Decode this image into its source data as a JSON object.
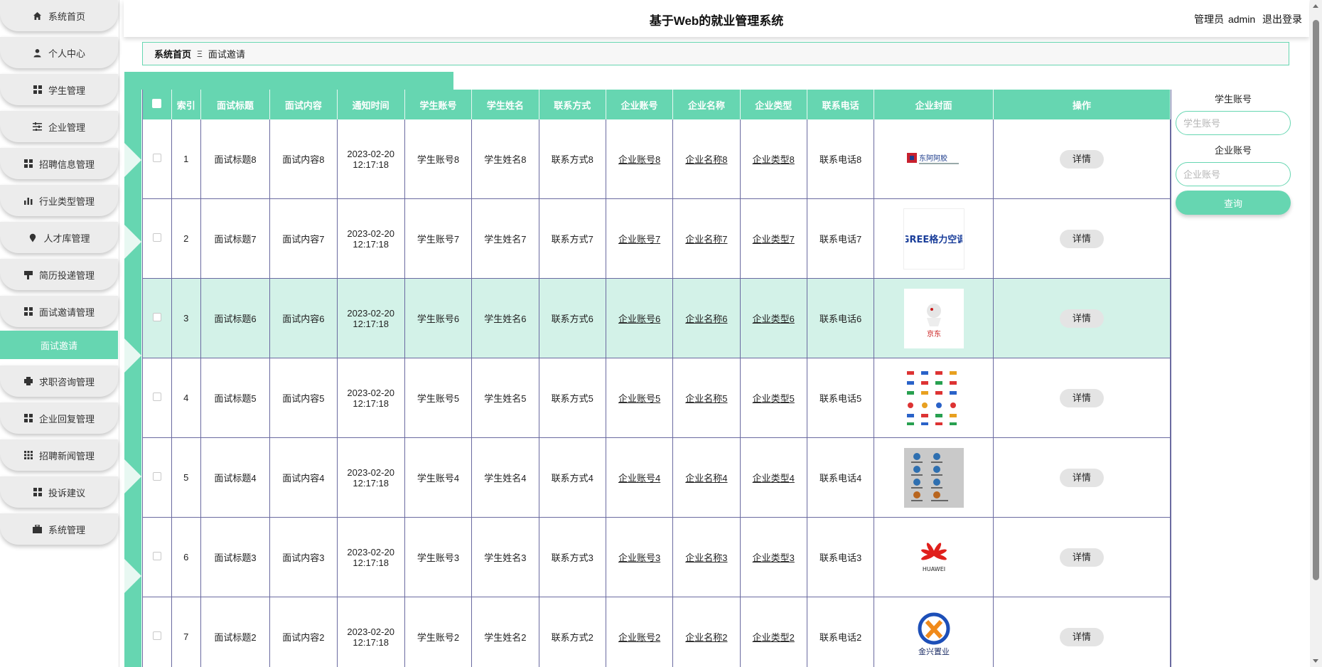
{
  "app": {
    "title": "基于Web的就业管理系统",
    "admin_role": "管理员",
    "admin_name": "admin",
    "logout": "退出登录"
  },
  "sidebar": {
    "items": [
      {
        "label": "系统首页",
        "icon": "home-icon"
      },
      {
        "label": "个人中心",
        "icon": "user-icon"
      },
      {
        "label": "学生管理",
        "icon": "grid-icon"
      },
      {
        "label": "企业管理",
        "icon": "sliders-icon"
      },
      {
        "label": "招聘信息管理",
        "icon": "grid-icon"
      },
      {
        "label": "行业类型管理",
        "icon": "bar-chart-icon"
      },
      {
        "label": "人才库管理",
        "icon": "pin-icon"
      },
      {
        "label": "简历投递管理",
        "icon": "flag-icon"
      },
      {
        "label": "面试邀请管理",
        "icon": "grid-icon"
      },
      {
        "label": "求职咨询管理",
        "icon": "printer-icon"
      },
      {
        "label": "企业回复管理",
        "icon": "grid-icon"
      },
      {
        "label": "招聘新闻管理",
        "icon": "grid9-icon"
      },
      {
        "label": "投诉建议",
        "icon": "grid-icon"
      },
      {
        "label": "系统管理",
        "icon": "briefcase-icon"
      }
    ],
    "active_sub": "面试邀请"
  },
  "breadcrumb": {
    "home": "系统首页",
    "separator": "Ξ",
    "current": "面试邀请"
  },
  "table": {
    "columns": [
      "索引",
      "面试标题",
      "面试内容",
      "通知时间",
      "学生账号",
      "学生姓名",
      "联系方式",
      "企业账号",
      "企业名称",
      "企业类型",
      "联系电话",
      "企业封面",
      "操作"
    ],
    "detail_label": "详情",
    "rows": [
      {
        "index": "1",
        "title": "面试标题8",
        "content": "面试内容8",
        "time": "2023-02-20 12:17:18",
        "student_account": "学生账号8",
        "student_name": "学生姓名8",
        "contact": "联系方式8",
        "company_account": "企业账号8",
        "company_name": "企业名称8",
        "company_type": "企业类型8",
        "phone": "联系电话8",
        "cover": "dongfang-logo",
        "cover_text": "东阿阿胶"
      },
      {
        "index": "2",
        "title": "面试标题7",
        "content": "面试内容7",
        "time": "2023-02-20 12:17:18",
        "student_account": "学生账号7",
        "student_name": "学生姓名7",
        "contact": "联系方式7",
        "company_account": "企业账号7",
        "company_name": "企业名称7",
        "company_type": "企业类型7",
        "phone": "联系电话7",
        "cover": "gree-logo",
        "cover_text": "GREE格力空调"
      },
      {
        "index": "3",
        "title": "面试标题6",
        "content": "面试内容6",
        "time": "2023-02-20 12:17:18",
        "student_account": "学生账号6",
        "student_name": "学生姓名6",
        "contact": "联系方式6",
        "company_account": "企业账号6",
        "company_name": "企业名称6",
        "company_type": "企业类型6",
        "phone": "联系电话6",
        "cover": "jd-logo",
        "cover_text": "京东"
      },
      {
        "index": "4",
        "title": "面试标题5",
        "content": "面试内容5",
        "time": "2023-02-20 12:17:18",
        "student_account": "学生账号5",
        "student_name": "学生姓名5",
        "contact": "联系方式5",
        "company_account": "企业账号5",
        "company_name": "企业名称5",
        "company_type": "企业类型5",
        "phone": "联系电话5",
        "cover": "logo-collage",
        "cover_text": ""
      },
      {
        "index": "5",
        "title": "面试标题4",
        "content": "面试内容4",
        "time": "2023-02-20 12:17:18",
        "student_account": "学生账号4",
        "student_name": "学生姓名4",
        "contact": "联系方式4",
        "company_account": "企业账号4",
        "company_name": "企业名称4",
        "company_type": "企业类型4",
        "phone": "联系电话4",
        "cover": "logo-sheet",
        "cover_text": ""
      },
      {
        "index": "6",
        "title": "面试标题3",
        "content": "面试内容3",
        "time": "2023-02-20 12:17:18",
        "student_account": "学生账号3",
        "student_name": "学生姓名3",
        "contact": "联系方式3",
        "company_account": "企业账号3",
        "company_name": "企业名称3",
        "company_type": "企业类型3",
        "phone": "联系电话3",
        "cover": "huawei-logo",
        "cover_text": "HUAWEI"
      },
      {
        "index": "7",
        "title": "面试标题2",
        "content": "面试内容2",
        "time": "2023-02-20 12:17:18",
        "student_account": "学生账号2",
        "student_name": "学生姓名2",
        "contact": "联系方式2",
        "company_account": "企业账号2",
        "company_name": "企业名称2",
        "company_type": "企业类型2",
        "phone": "联系电话2",
        "cover": "jinxing-logo",
        "cover_text": "金兴置业"
      }
    ]
  },
  "search": {
    "student_label": "学生账号",
    "student_placeholder": "学生账号",
    "company_label": "企业账号",
    "company_placeholder": "企业账号",
    "button": "查询"
  },
  "colors": {
    "accent": "#66d6b1",
    "highlight_row": "#d3f2e8"
  }
}
